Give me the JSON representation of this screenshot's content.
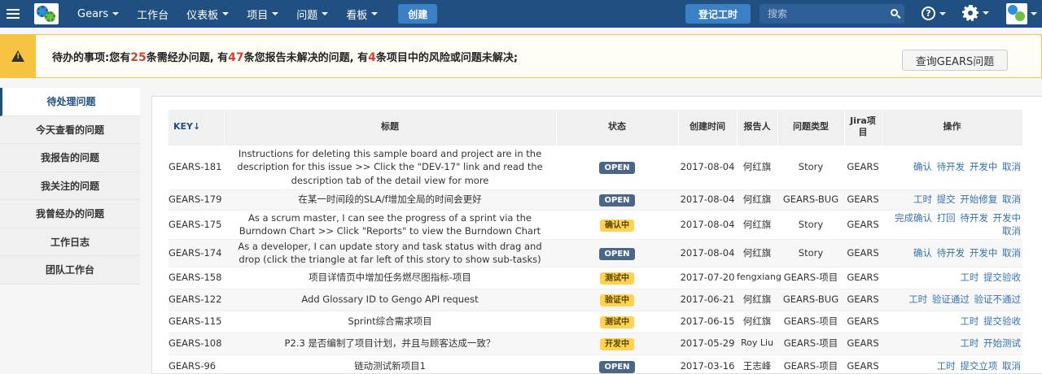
{
  "nav": {
    "product": "Gears",
    "items": [
      "工作台",
      "仪表板",
      "项目",
      "问题",
      "看板"
    ],
    "item_has_caret": [
      false,
      true,
      true,
      true,
      true
    ],
    "create_label": "创建",
    "log_work_label": "登记工时",
    "search_placeholder": "搜索"
  },
  "banner": {
    "prefix": "待办的事项:您有",
    "count1": "25",
    "text1": "条需经办问题, 有",
    "count2": "47",
    "text2": "条您报告未解决的问题, 有",
    "count3": "4",
    "text3": "条项目中的风险或问题未解决;",
    "button_label": "查询GEARS问题"
  },
  "sidebar": {
    "items": [
      {
        "label": "待处理问题",
        "active": true
      },
      {
        "label": "今天查看的问题",
        "active": false
      },
      {
        "label": "我报告的问题",
        "active": false
      },
      {
        "label": "我关注的问题",
        "active": false
      },
      {
        "label": "我曾经办的问题",
        "active": false
      },
      {
        "label": "工作日志",
        "active": false
      },
      {
        "label": "团队工作台",
        "active": false
      }
    ]
  },
  "table": {
    "headers": [
      "KEY↓",
      "标题",
      "状态",
      "创建时间",
      "报告人",
      "问题类型",
      "Jira项目",
      "操作"
    ],
    "rows": [
      {
        "key": "GEARS-181",
        "title": "Instructions for deleting this sample board and project are in the description for this issue >> Click the \"DEV-17\" link and read the description tab of the detail view for more",
        "status": "OPEN",
        "status_style": "open",
        "created": "2017-08-04",
        "reporter": "何红旗",
        "type": "Story",
        "project": "GEARS",
        "actions": [
          "确认",
          "待开发",
          "开发中",
          "取消"
        ]
      },
      {
        "key": "GEARS-179",
        "title": "在某一时间段的SLA/f增加全局的时间会更好",
        "status": "OPEN",
        "status_style": "open",
        "created": "2017-08-04",
        "reporter": "何红旗",
        "type": "GEARS-BUG",
        "project": "GEARS",
        "actions": [
          "工时",
          "提交",
          "开始修复",
          "取消"
        ]
      },
      {
        "key": "GEARS-175",
        "title": "As a scrum master, I can see the progress of a sprint via the Burndown Chart >> Click \"Reports\" to view the Burndown Chart",
        "status": "确认中",
        "status_style": "yellow",
        "created": "2017-08-04",
        "reporter": "何红旗",
        "type": "Story",
        "project": "GEARS",
        "actions": [
          "完成确认",
          "打回",
          "待开发",
          "开发中",
          "取消"
        ]
      },
      {
        "key": "GEARS-174",
        "title": "As a developer, I can update story and task status with drag and drop (click the triangle at far left of this story to show sub-tasks)",
        "status": "OPEN",
        "status_style": "open",
        "created": "2017-08-04",
        "reporter": "何红旗",
        "type": "Story",
        "project": "GEARS",
        "actions": [
          "确认",
          "待开发",
          "开发中",
          "取消"
        ]
      },
      {
        "key": "GEARS-158",
        "title": "项目详情页中增加任务燃尽图指标-项目",
        "status": "测试中",
        "status_style": "yellow",
        "created": "2017-07-20",
        "reporter": "fengxiang",
        "type": "GEARS-项目",
        "project": "GEARS",
        "actions": [
          "工时",
          "提交验收"
        ]
      },
      {
        "key": "GEARS-122",
        "title": "Add Glossary ID to Gengo API request",
        "status": "验证中",
        "status_style": "yellow",
        "created": "2017-06-21",
        "reporter": "何红旗",
        "type": "GEARS-BUG",
        "project": "GEARS",
        "actions": [
          "工时",
          "验证通过",
          "验证不通过"
        ]
      },
      {
        "key": "GEARS-115",
        "title": "Sprint综合需求项目",
        "status": "测试中",
        "status_style": "yellow",
        "created": "2017-06-15",
        "reporter": "何红旗",
        "type": "GEARS-项目",
        "project": "GEARS",
        "actions": [
          "工时",
          "提交验收"
        ]
      },
      {
        "key": "GEARS-108",
        "title": "P2.3 是否编制了项目计划，并且与顾客达成一致？",
        "status": "开发中",
        "status_style": "yellow",
        "created": "2017-05-29",
        "reporter": "Roy Liu",
        "type": "GEARS-项目",
        "project": "GEARS",
        "actions": [
          "工时",
          "开始测试"
        ]
      },
      {
        "key": "GEARS-96",
        "title": "链动测试新项目1",
        "status": "OPEN",
        "status_style": "open",
        "created": "2017-03-16",
        "reporter": "王志峰",
        "type": "GEARS-项目",
        "project": "GEARS",
        "actions": [
          "工时",
          "提交立项",
          "取消"
        ]
      }
    ]
  }
}
